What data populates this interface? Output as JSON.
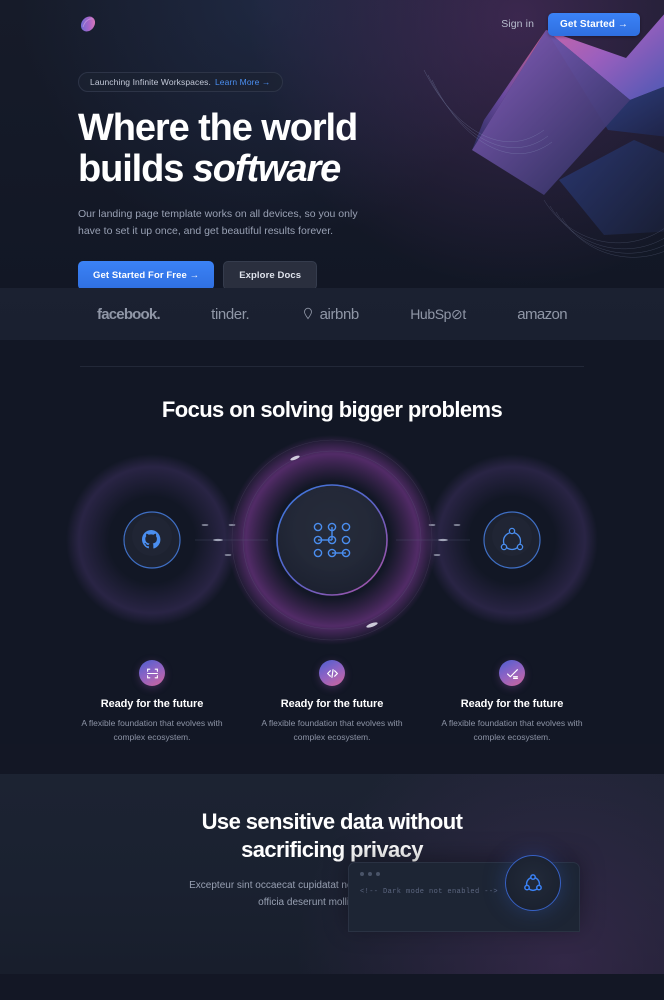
{
  "nav": {
    "logo_icon": "brand-gem-logo",
    "signin_label": "Sign in",
    "cta_label": "Get Started →"
  },
  "hero": {
    "badge_text": "Launching Infinite Workspaces.",
    "badge_link": "Learn More →",
    "title_line1": "Where the world",
    "title_line2_plain": "builds ",
    "title_line2_italic": "software",
    "subtitle": "Our landing page template works on all devices, so you only have to set it up once, and get beautiful results forever.",
    "cta_primary": "Get Started For Free →",
    "cta_secondary": "Explore Docs"
  },
  "logos": {
    "items": [
      {
        "name": "facebook",
        "label": "facebook."
      },
      {
        "name": "tinder",
        "label": "tinder."
      },
      {
        "name": "airbnb",
        "label": "airbnb"
      },
      {
        "name": "hubspot",
        "label": "HubSp⊘t"
      },
      {
        "name": "amazon",
        "label": "amazon"
      }
    ]
  },
  "focus": {
    "title": "Focus on solving bigger problems",
    "orbit": {
      "left_icon": "github-icon",
      "center_icon": "node-grid-icon",
      "right_icon": "network-circle-icon"
    }
  },
  "features": [
    {
      "icon": "resize-frame-icon",
      "title": "Ready for the future",
      "desc": "A flexible foundation that evolves with complex ecosystem."
    },
    {
      "icon": "code-brackets-icon",
      "title": "Ready for the future",
      "desc": "A flexible foundation that evolves with complex ecosystem."
    },
    {
      "icon": "check-chart-icon",
      "title": "Ready for the future",
      "desc": "A flexible foundation that evolves with complex ecosystem."
    }
  ],
  "privacy": {
    "title_line1": "Use sensitive data without",
    "title_line2": "sacrificing privacy",
    "subtitle": "Excepteur sint occaecat cupidatat non proident, sunt in culpa qui officia deserunt mollit anim id est.",
    "code_snippet": "<!-- Dark mode not enabled -->",
    "badge_icon": "network-circle-icon"
  },
  "colors": {
    "accent_blue": "#3b82f6",
    "link_blue": "#4a8ef0",
    "bg_dark": "#121725",
    "bg_band": "#1b2131",
    "bg_privacy": "#1c2332",
    "text_muted": "#98a0b2"
  }
}
